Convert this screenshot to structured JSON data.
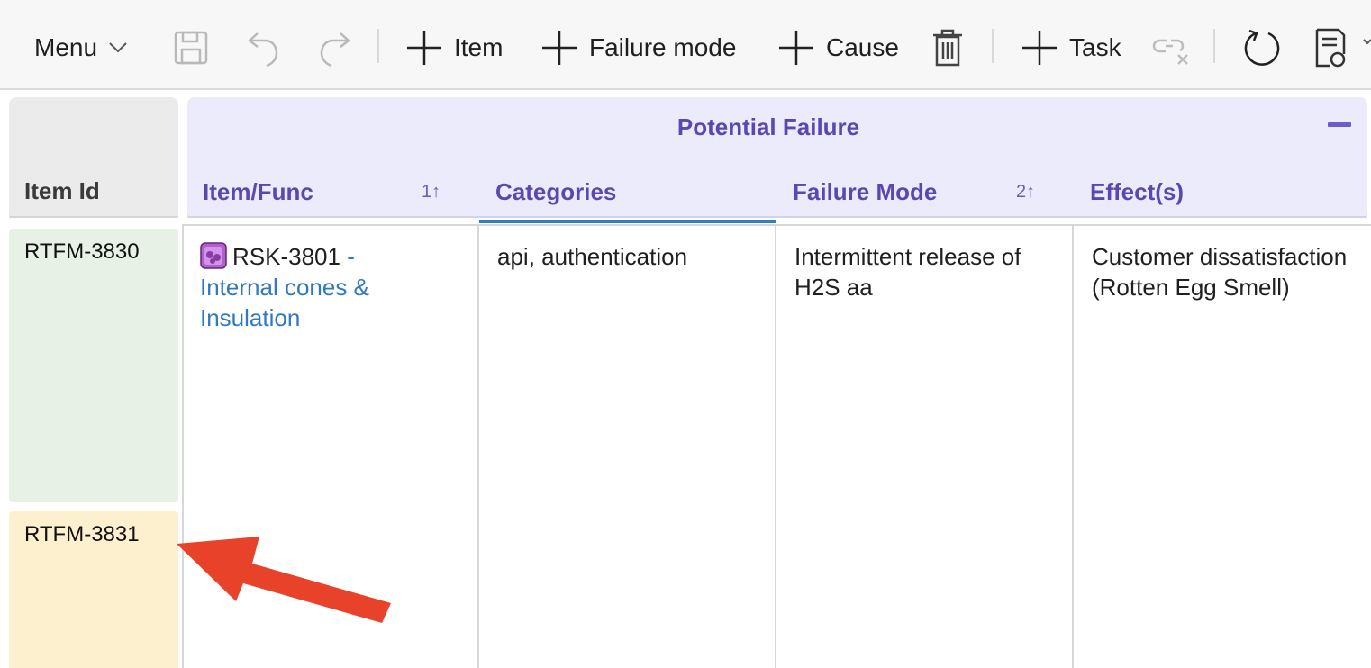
{
  "toolbar": {
    "menu_label": "Menu",
    "add_item_label": "Item",
    "add_failure_mode_label": "Failure mode",
    "add_cause_label": "Cause",
    "add_task_label": "Task"
  },
  "grid": {
    "item_id_header": "Item Id",
    "group_title": "Potential Failure",
    "columns": [
      {
        "label": "Item/Func",
        "sort": "1↑"
      },
      {
        "label": "Categories",
        "sort": ""
      },
      {
        "label": "Failure Mode",
        "sort": "2↑"
      },
      {
        "label": "Effect(s)",
        "sort": ""
      }
    ],
    "rows": [
      {
        "item_id": "RTFM-3830",
        "risk_id": "RSK-3801",
        "risk_sep": " - ",
        "risk_name": "Internal cones & Insulation",
        "categories": "api, authentication",
        "failure_mode": "Intermittent release of H2S aa",
        "effects": "Customer dissatisfaction (Rotten Egg Smell)"
      },
      {
        "item_id": "RTFM-3831"
      }
    ]
  },
  "colors": {
    "accent_purple": "#5b47b2",
    "link_blue": "#2f78c4",
    "row_green": "#e7f1e5",
    "row_yellow": "#fdf0cf",
    "annotation_red": "#e8432a"
  }
}
